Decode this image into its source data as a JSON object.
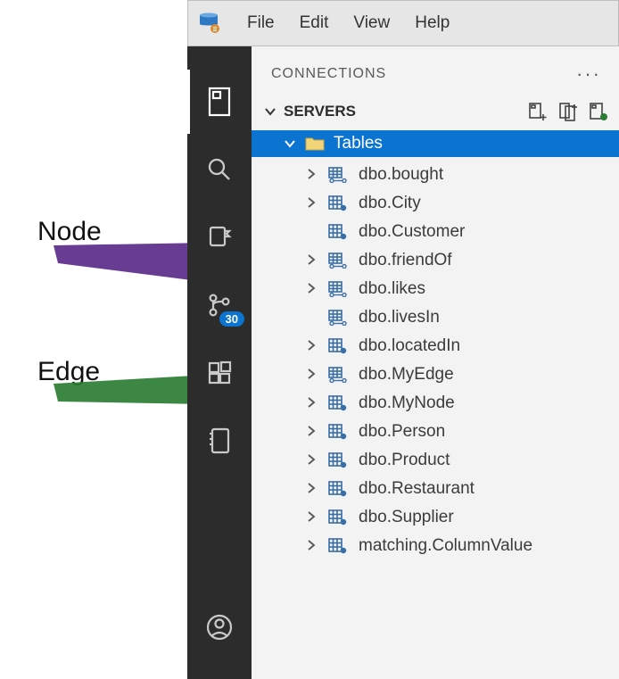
{
  "annotations": {
    "node": "Node",
    "edge": "Edge"
  },
  "menubar": {
    "items": [
      "File",
      "Edit",
      "View",
      "Help"
    ]
  },
  "activitybar": {
    "badge": "30"
  },
  "panel": {
    "title": "CONNECTIONS",
    "section": "SERVERS",
    "tables_label": "Tables"
  },
  "tables": [
    {
      "name": "dbo.bought",
      "type": "edge",
      "expandable": true
    },
    {
      "name": "dbo.City",
      "type": "node",
      "expandable": true
    },
    {
      "name": "dbo.Customer",
      "type": "node",
      "expandable": false
    },
    {
      "name": "dbo.friendOf",
      "type": "edge",
      "expandable": true
    },
    {
      "name": "dbo.likes",
      "type": "edge",
      "expandable": true
    },
    {
      "name": "dbo.livesIn",
      "type": "edge",
      "expandable": false
    },
    {
      "name": "dbo.locatedIn",
      "type": "node",
      "expandable": true
    },
    {
      "name": "dbo.MyEdge",
      "type": "edge",
      "expandable": true
    },
    {
      "name": "dbo.MyNode",
      "type": "node",
      "expandable": true
    },
    {
      "name": "dbo.Person",
      "type": "node",
      "expandable": true
    },
    {
      "name": "dbo.Product",
      "type": "node",
      "expandable": true
    },
    {
      "name": "dbo.Restaurant",
      "type": "node",
      "expandable": true
    },
    {
      "name": "dbo.Supplier",
      "type": "node",
      "expandable": true
    },
    {
      "name": "matching.ColumnValue",
      "type": "node",
      "expandable": true
    }
  ]
}
